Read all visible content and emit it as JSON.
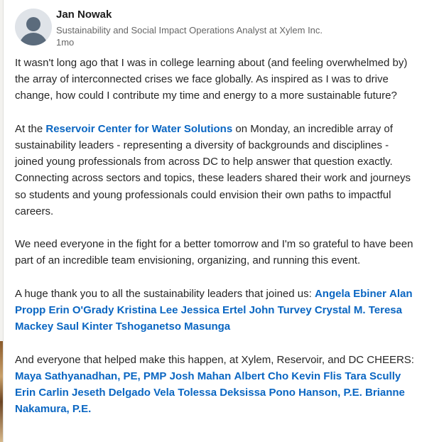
{
  "post": {
    "author": "Jan Nowak",
    "headline": "Sustainability and Social Impact Operations Analyst at Xylem Inc.",
    "time": "1mo",
    "p1": "It wasn't long ago that I was in college learning about (and feeling overwhelmed by) the array of interconnected crises we face globally. As inspired as I was to drive change, how could I contribute my time and energy to a more sustainable future?",
    "p2_before": "At the ",
    "p2_link": "Reservoir Center for Water Solutions",
    "p2_after": " on Monday, an incredible array of sustainability leaders - representing a diversity of backgrounds and disciplines - joined young professionals from across DC to help answer that question exactly. Connecting across sectors and topics, these leaders shared their work and journeys so students and young professionals could envision their own paths to impactful careers.",
    "p3": "We need everyone in the fight for a better tomorrow and I'm so grateful to have been part of an incredible team envisioning, organizing, and running this event.",
    "p4_intro": "A huge thank you to all the sustainability leaders that joined us: ",
    "leaders": [
      "Angela Ebiner",
      "Alan Propp",
      "Erin O'Grady",
      "Kristina Lee",
      "Jessica Ertel",
      "John Turvey",
      "Crystal M.",
      "Teresa Mackey",
      "Saul Kinter",
      "Tshoganetso Masunga"
    ],
    "p5_intro": "And everyone that helped make this happen, at Xylem, Reservoir, and DC CHEERS:",
    "helpers": [
      "Maya Sathyanadhan, PE, PMP",
      "Josh Mahan",
      "Albert Cho",
      "Kevin Flis",
      "Tara Scully",
      "Erin Carlin",
      "Jeseth Delgado Vela",
      "Tolessa Deksissa",
      "Pono Hanson, P.E.",
      "Brianne Nakamura, P.E."
    ]
  },
  "colors": {
    "link": "#0a66c2",
    "text": "#262626",
    "muted": "#666666"
  },
  "icons": {
    "avatar": "person-placeholder-icon"
  }
}
